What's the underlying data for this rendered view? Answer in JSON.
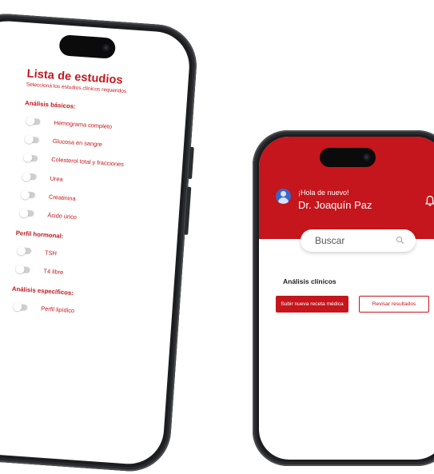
{
  "study_list": {
    "title": "Lista de estudios",
    "subtitle": "Seleccioná los estudios clínicos requeridos",
    "sections": [
      {
        "heading": "Análisis básicos:",
        "items": [
          "Hemograma completo",
          "Glucosa en sangre",
          "Colesterol total y fracciones",
          "Urea",
          "Creatinina",
          "Ácido úrico"
        ]
      },
      {
        "heading": "Perfil hormonal:",
        "items": [
          "TSH",
          "T4 libre"
        ]
      },
      {
        "heading": "Análisis específicos:",
        "items": [
          "Perfil lipídico"
        ]
      }
    ]
  },
  "home": {
    "greeting": "¡Hola de nuevo!",
    "doctor_name": "Dr. Joaquín Paz",
    "search_placeholder": "Buscar",
    "section_title": "Análisis clínicos",
    "upload_button": "Subir nueva receta médica",
    "review_button": "Revisar resultados"
  },
  "colors": {
    "brand_red": "#c4161c",
    "toggle_off": "#cfcfd2",
    "avatar_blue": "#3a66c8"
  },
  "icons": {
    "search": "search-icon",
    "bell": "bell-icon",
    "avatar": "user-avatar-icon"
  }
}
